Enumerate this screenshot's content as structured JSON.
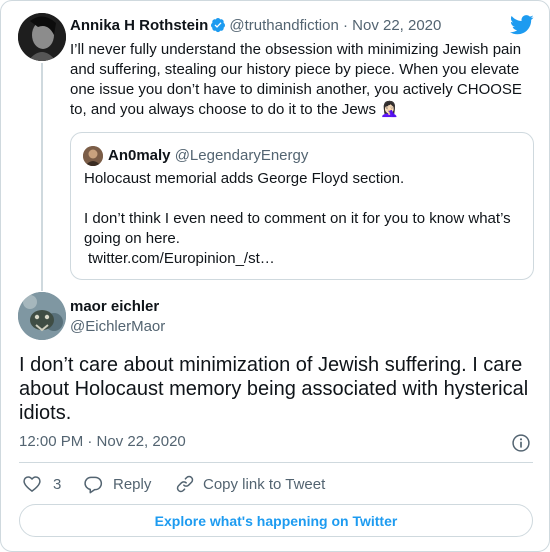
{
  "parent_tweet": {
    "author_name": "Annika H Rothstein",
    "author_handle": "@truthandfiction",
    "separator": "·",
    "date": "Nov 22, 2020",
    "text": "I’ll never fully understand the obsession with minimizing Jewish pain and suffering, stealing our history piece by piece. When you elevate one issue you don’t have to diminish another, you actively CHOOSE to, and you always choose to do it to the Jews 🤦🏻‍♀️"
  },
  "quoted_tweet": {
    "author_name": "An0maly",
    "author_handle": "@LegendaryEnergy",
    "line1": "Holocaust memorial adds George Floyd section.",
    "line2": "I don’t think I even need to comment on it for you to know what’s going on here.",
    "link": "twitter.com/Europinion_/st…"
  },
  "main_tweet": {
    "author_name": "maor eichler",
    "author_handle": "@EichlerMaor",
    "text": "I don’t care about minimization of Jewish suffering. I care about Holocaust memory being associated with hysterical idiots.",
    "timestamp": "12:00 PM · Nov 22, 2020"
  },
  "actions": {
    "like_count": "3",
    "reply_label": "Reply",
    "copy_link_label": "Copy link to Tweet"
  },
  "footer": {
    "explore_label": "Explore what's happening on Twitter"
  },
  "colors": {
    "brand_blue": "#1d9bf0",
    "text_primary": "#0f1419",
    "text_secondary": "#536471",
    "border": "#cfd9de"
  },
  "icons": [
    "twitter-bird-icon",
    "verified-badge-icon",
    "info-icon",
    "heart-icon",
    "reply-bubble-icon",
    "link-icon"
  ]
}
